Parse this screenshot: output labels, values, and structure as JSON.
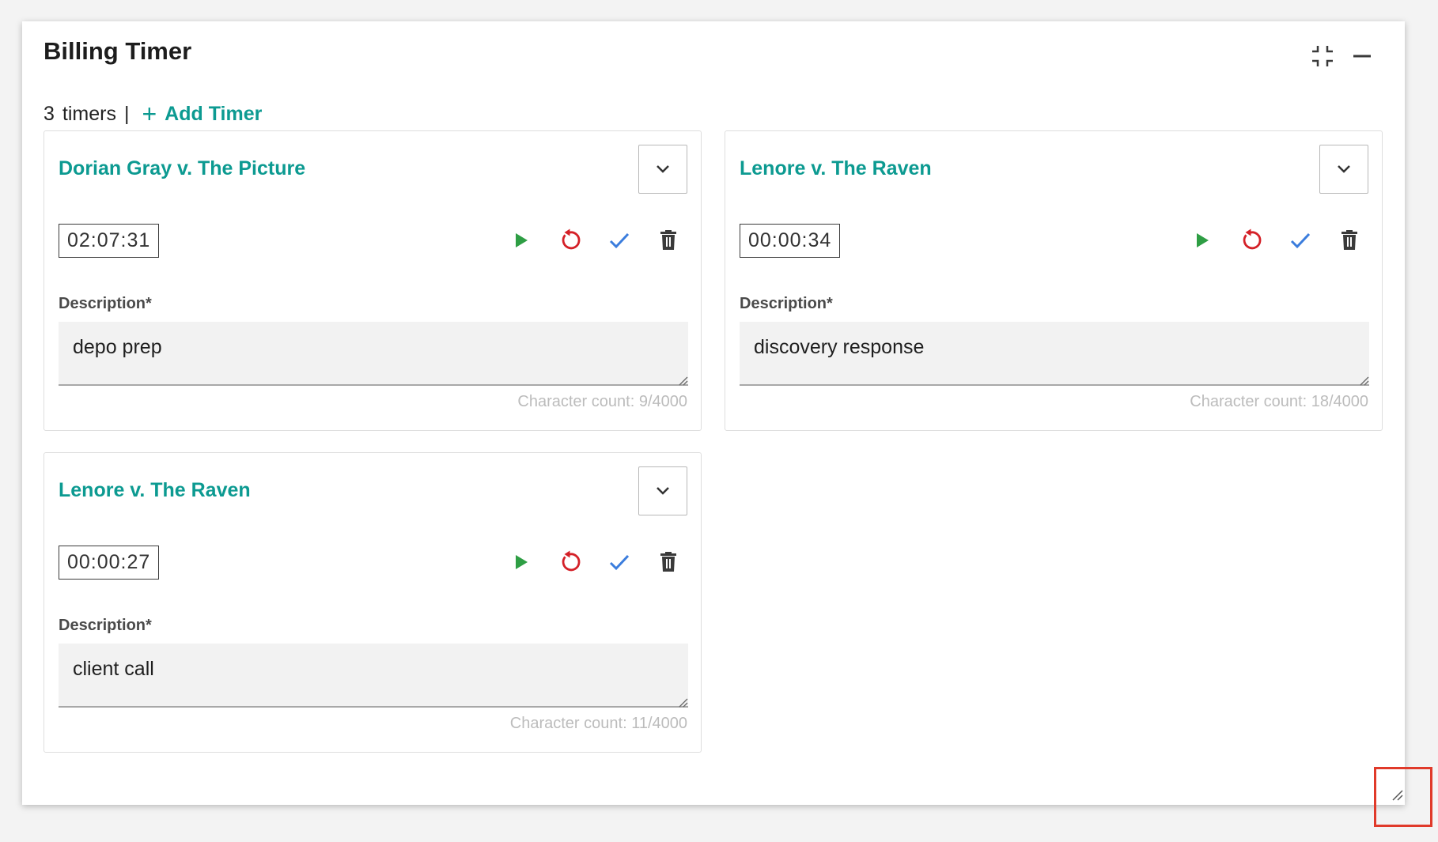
{
  "panel": {
    "title": "Billing Timer",
    "timer_count": "3",
    "timers_word": "timers",
    "separator": "|",
    "add_timer_label": "Add Timer"
  },
  "timers": [
    {
      "title": "Dorian Gray v. The Picture",
      "time": "02:07:31",
      "description_label": "Description*",
      "description": "depo prep",
      "char_count": "Character count: 9/4000"
    },
    {
      "title": "Lenore v. The Raven",
      "time": "00:00:34",
      "description_label": "Description*",
      "description": "discovery response",
      "char_count": "Character count: 18/4000"
    },
    {
      "title": "Lenore v. The Raven",
      "time": "00:00:27",
      "description_label": "Description*",
      "description": "client call",
      "char_count": "Character count: 11/4000"
    }
  ],
  "colors": {
    "accent": "#0c9a91",
    "play": "#2e9e44",
    "reset": "#d42027",
    "confirm": "#3b7ddd",
    "delete": "#3a3a3a",
    "highlight_box": "#e03a2a"
  },
  "icons": {
    "collapse": "compress-icon",
    "minimize": "minimize-icon",
    "dropdown": "chevron-down-icon",
    "play": "play-icon",
    "reset": "reset-icon",
    "confirm": "check-icon",
    "delete": "trash-icon",
    "resize": "resize-grip-icon"
  }
}
